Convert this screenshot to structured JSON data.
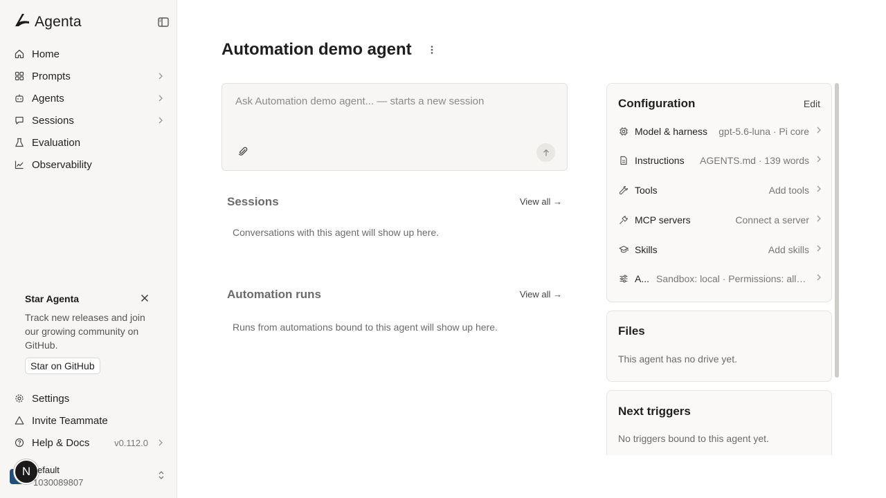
{
  "brand": {
    "name": "Agenta"
  },
  "nav": {
    "items": [
      {
        "label": "Home",
        "icon": "home-icon",
        "has_chevron": false
      },
      {
        "label": "Prompts",
        "icon": "grid-icon",
        "has_chevron": true
      },
      {
        "label": "Agents",
        "icon": "bot-icon",
        "has_chevron": true
      },
      {
        "label": "Sessions",
        "icon": "chat-icon",
        "has_chevron": true
      },
      {
        "label": "Evaluation",
        "icon": "flask-icon",
        "has_chevron": false
      },
      {
        "label": "Observability",
        "icon": "chart-icon",
        "has_chevron": false
      }
    ]
  },
  "promo": {
    "title": "Star Agenta",
    "text": "Track new releases and join our growing community on GitHub.",
    "button": "Star on GitHub"
  },
  "bottom_nav": {
    "settings": "Settings",
    "invite": "Invite Teammate",
    "help": "Help & Docs",
    "version": "v0.112.0"
  },
  "org": {
    "badge": "N",
    "name": "efault",
    "id": "1030089807"
  },
  "page": {
    "title": "Automation demo agent"
  },
  "composer": {
    "placeholder": "Ask Automation demo agent... — starts a new session"
  },
  "sessions": {
    "title": "Sessions",
    "view_all": "View all →",
    "empty": "Conversations with this agent will show up here."
  },
  "automation_runs": {
    "title": "Automation runs",
    "view_all": "View all →",
    "empty": "Runs from automations bound to this agent will show up here."
  },
  "configuration": {
    "title": "Configuration",
    "edit": "Edit",
    "rows": [
      {
        "name": "Model & harness",
        "value": "gpt-5.6-luna · Pi core",
        "icon": "chip-icon"
      },
      {
        "name": "Instructions",
        "value": "AGENTS.md · 139 words",
        "icon": "document-icon"
      },
      {
        "name": "Tools",
        "value": "Add tools",
        "icon": "wrench-icon"
      },
      {
        "name": "MCP servers",
        "value": "Connect a server",
        "icon": "plug-icon"
      },
      {
        "name": "Skills",
        "value": "Add skills",
        "icon": "graduation-cap-icon"
      },
      {
        "name": "A...",
        "value": "Sandbox: local · Permissions: allo...",
        "icon": "sliders-icon"
      }
    ]
  },
  "files": {
    "title": "Files",
    "empty": "This agent has no drive yet."
  },
  "next_triggers": {
    "title": "Next triggers",
    "empty": "No triggers bound to this agent yet."
  }
}
